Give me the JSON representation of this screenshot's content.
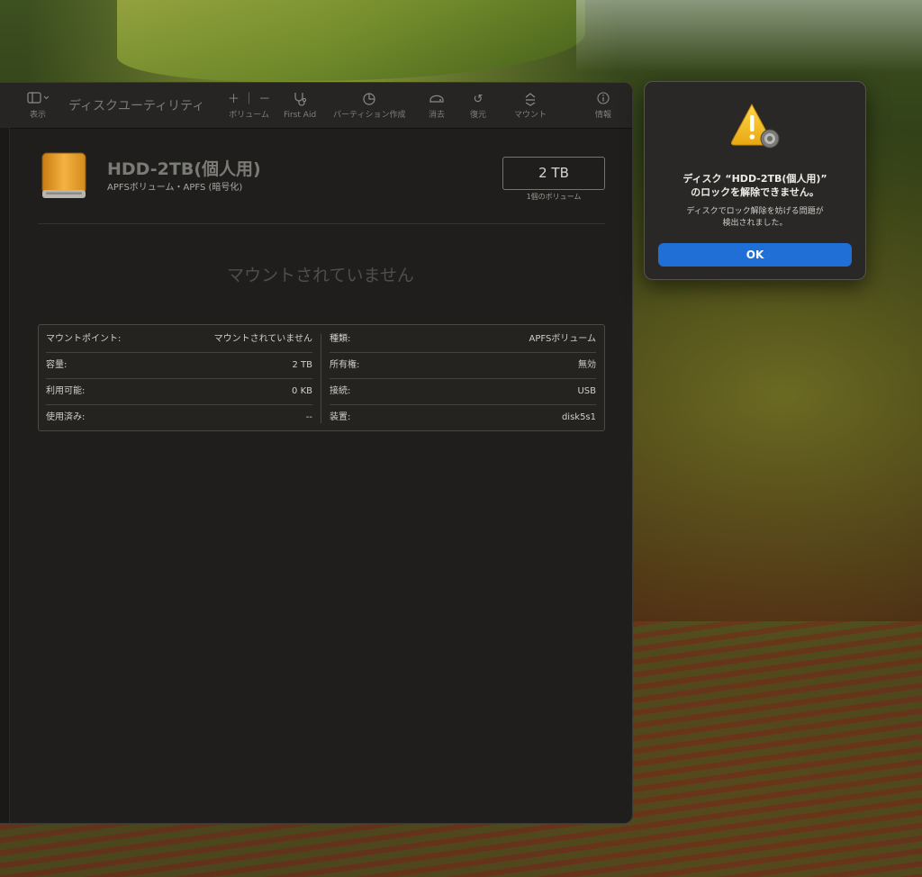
{
  "app": {
    "title": "ディスクユーティリティ"
  },
  "toolbar": {
    "view_label": "表示",
    "volume_label": "ボリューム",
    "first_aid_label": "First Aid",
    "partition_label": "パーティション作成",
    "erase_label": "消去",
    "restore_label": "復元",
    "mount_label": "マウント",
    "info_label": "情報"
  },
  "volume": {
    "name": "HDD-2TB(個人用)",
    "subtitle": "APFSボリューム・APFS (暗号化)",
    "size": "2 TB",
    "size_caption": "1個のボリューム",
    "status": "マウントされていません"
  },
  "info_table": {
    "left": [
      {
        "key": "マウントポイント:",
        "value": "マウントされていません"
      },
      {
        "key": "容量:",
        "value": "2 TB"
      },
      {
        "key": "利用可能:",
        "value": "0 KB"
      },
      {
        "key": "使用済み:",
        "value": "--"
      }
    ],
    "right": [
      {
        "key": "種類:",
        "value": "APFSボリューム"
      },
      {
        "key": "所有権:",
        "value": "無効"
      },
      {
        "key": "接続:",
        "value": "USB"
      },
      {
        "key": "装置:",
        "value": "disk5s1"
      }
    ]
  },
  "alert": {
    "title_line1": "ディスク “HDD-2TB(個人用)”",
    "title_line2": "のロックを解除できません。",
    "message_line1": "ディスクでロック解除を妨げる問題が",
    "message_line2": "検出されました。",
    "ok_label": "OK"
  },
  "icons": {
    "sidebar_toggle": "sidebar-icon",
    "add": "plus-icon",
    "remove": "minus-icon",
    "first_aid": "stethoscope-icon",
    "partition": "pie-icon",
    "erase": "eraser-icon",
    "restore": "restore-icon",
    "mount": "mount-icon",
    "info": "info-icon",
    "warning": "warning-icon"
  },
  "colors": {
    "accent": "#1f6fd6",
    "disk": "#f0a830",
    "warning": "#f2c018"
  }
}
